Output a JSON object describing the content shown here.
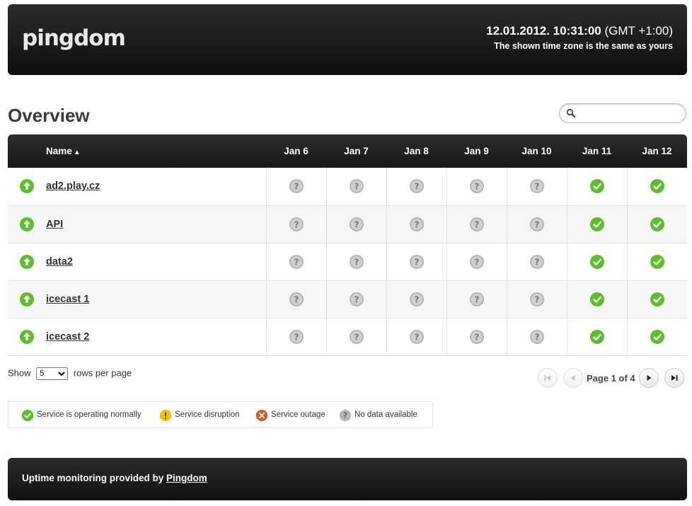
{
  "header": {
    "logo": "pingdom",
    "datetime": "12.01.2012. 10:31:00",
    "timezone": " (GMT +1:00)",
    "note": "The shown time zone is the same as yours"
  },
  "page": {
    "title": "Overview"
  },
  "search": {
    "placeholder": "",
    "value": ""
  },
  "table": {
    "name_header": "Name",
    "sort_indicator": "▲",
    "days": [
      "Jan 6",
      "Jan 7",
      "Jan 8",
      "Jan 9",
      "Jan 10",
      "Jan 11",
      "Jan 12"
    ],
    "rows": [
      {
        "status": "up",
        "name": "ad2.play.cz",
        "days": [
          "nodata",
          "nodata",
          "nodata",
          "nodata",
          "nodata",
          "ok",
          "ok"
        ]
      },
      {
        "status": "up",
        "name": "API",
        "days": [
          "nodata",
          "nodata",
          "nodata",
          "nodata",
          "nodata",
          "ok",
          "ok"
        ]
      },
      {
        "status": "up",
        "name": "data2",
        "days": [
          "nodata",
          "nodata",
          "nodata",
          "nodata",
          "nodata",
          "ok",
          "ok"
        ]
      },
      {
        "status": "up",
        "name": "icecast 1",
        "days": [
          "nodata",
          "nodata",
          "nodata",
          "nodata",
          "nodata",
          "ok",
          "ok"
        ]
      },
      {
        "status": "up",
        "name": "icecast 2",
        "days": [
          "nodata",
          "nodata",
          "nodata",
          "nodata",
          "nodata",
          "ok",
          "ok"
        ]
      }
    ]
  },
  "rows_per_page": {
    "prefix": "Show",
    "value": "5",
    "suffix": "rows per page"
  },
  "pagination": {
    "info": "Page 1 of 4"
  },
  "legend": {
    "ok": "Service is operating normally",
    "disruption": "Service disruption",
    "outage": "Service outage",
    "nodata": "No data available"
  },
  "footer": {
    "text": "Uptime monitoring provided by ",
    "link": "Pingdom"
  },
  "colors": {
    "ok": "#5cbf2a",
    "up": "#5cbf2a",
    "disruption": "#f2c200",
    "outage": "#e0542d",
    "nodata": "#b5b5b5",
    "header_bg": "#1a1a1a"
  },
  "icons": {
    "up": "arrow-up-icon",
    "ok": "check-icon",
    "nodata": "question-icon",
    "disruption": "warning-icon",
    "outage": "cross-icon"
  }
}
